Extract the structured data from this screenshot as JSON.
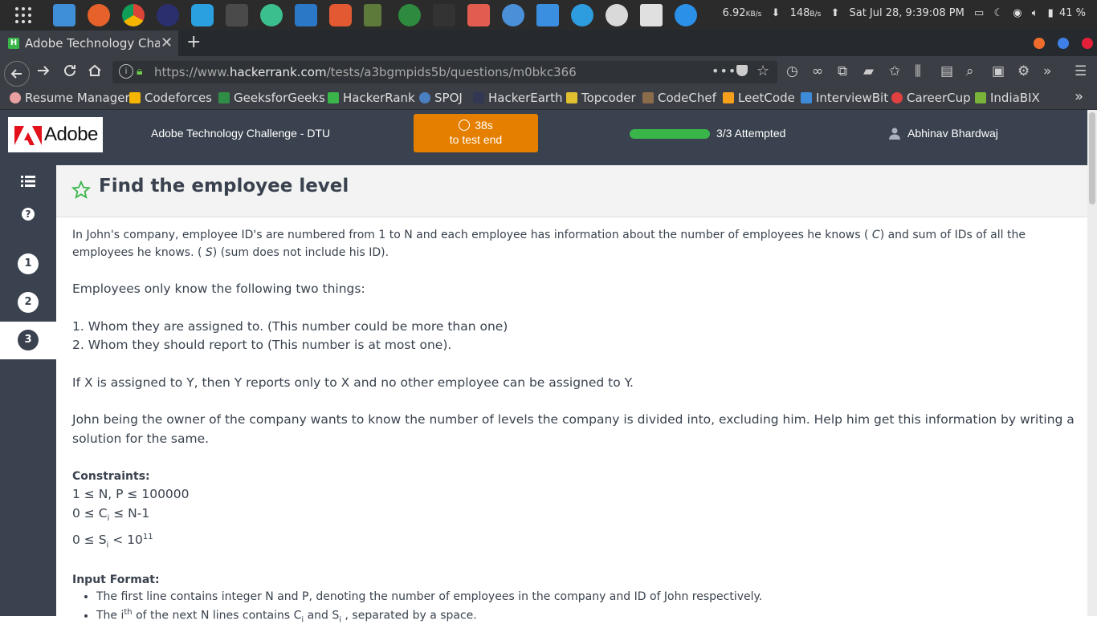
{
  "system_bar": {
    "net_down": "6.92",
    "net_down_unit": "KB/s",
    "net_up": "148",
    "net_up_unit": "B/s",
    "datetime": "Sat Jul 28,  9:39:08 PM",
    "battery": "41 %"
  },
  "browser": {
    "tab_title": "Adobe Technology Challe",
    "url_prefix": "https://www.",
    "url_domain": "hackerrank.com",
    "url_path": "/tests/a3bgmpids5b/questions/m0bkc366",
    "bookmarks": [
      {
        "label": "Resume Manager",
        "color": "#e8a0a0"
      },
      {
        "label": "Codeforces",
        "color": "#f4b400"
      },
      {
        "label": "GeeksforGeeks",
        "color": "#2f8d46"
      },
      {
        "label": "HackerRank",
        "color": "#39b54a"
      },
      {
        "label": "SPOJ",
        "color": "#4a7fc1"
      },
      {
        "label": "HackerEarth",
        "color": "#323754"
      },
      {
        "label": "Topcoder",
        "color": "#e0c030"
      },
      {
        "label": "CodeChef",
        "color": "#8b6b4a"
      },
      {
        "label": "LeetCode",
        "color": "#f89f1b"
      },
      {
        "label": "InterviewBit",
        "color": "#3d8bd9"
      },
      {
        "label": "CareerCup",
        "color": "#e04040"
      },
      {
        "label": "IndiaBIX",
        "color": "#7ab33a"
      }
    ]
  },
  "header": {
    "logo_text": "Adobe",
    "challenge_name": "Adobe Technology Challenge - DTU",
    "timer_value": "38s",
    "timer_label": "to test end",
    "progress_fraction": 1.0,
    "attempted_text": "3/3 Attempted",
    "user_name": "Abhinav Bhardwaj",
    "accent_color": "#e57f00",
    "success_color": "#39b54a"
  },
  "sidebar": {
    "questions": [
      "1",
      "2",
      "3"
    ],
    "active_question": "3"
  },
  "question": {
    "title": "Find the employee level",
    "intro_1": "In John's company, employee ID's are numbered from 1 to N and each employee has information about the number of employees he knows ( ",
    "intro_c": "C",
    "intro_2": ") and sum of IDs of all the employees he knows. ( ",
    "intro_s": "S",
    "intro_3": ") (sum does not include his ID).",
    "know_line": "Employees only know the following two things:",
    "item_1": "1. Whom they are assigned to. (This number could be more than one)",
    "item_2": "2. Whom they should report to (This number is at most one).",
    "rule_line": "If X is assigned to Y, then Y reports only to X and no other employee can be assigned to Y.",
    "task_line": "John being the owner of the company wants to know the number of levels the company is divided into, excluding him. Help him get this information by writing a solution for the same.",
    "constraints_heading": "Constraints:",
    "constraint_1": "1 ≤ N, P ≤ 100000",
    "constraint_2_a": "0 ≤ C",
    "constraint_2_sub": "i",
    "constraint_2_b": " ≤ N-1",
    "constraint_3_a": "0 ≤ S",
    "constraint_3_sub": "i",
    "constraint_3_b": " < 10",
    "constraint_3_sup": "11",
    "input_heading": "Input Format:",
    "input_1": "The first line contains integer N  and P, denoting the number of employees in the company and ID of John respectively.",
    "input_2_a": "The i",
    "input_2_sup": "th",
    "input_2_b": " of the next N lines contains C",
    "input_2_sub1": "i",
    "input_2_c": " and S",
    "input_2_sub2": "i",
    "input_2_d": " , separated by a space."
  }
}
